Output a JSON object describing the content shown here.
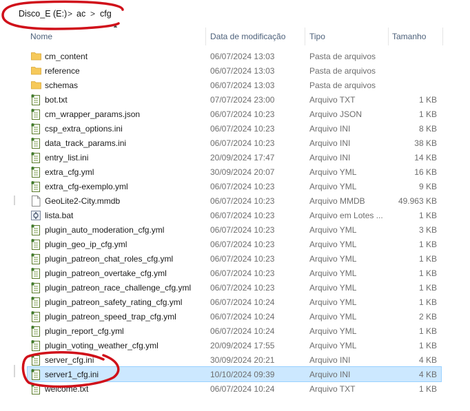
{
  "breadcrumb": {
    "items": [
      "Disco_E (E:)",
      "ac",
      "cfg"
    ],
    "separator": ">"
  },
  "columns": {
    "name": "Nome",
    "date": "Data de modificação",
    "type": "Tipo",
    "size": "Tamanho"
  },
  "files": [
    {
      "name": "cm_content",
      "date": "06/07/2024 13:03",
      "type": "Pasta de arquivos",
      "size": "",
      "icon": "folder-icon"
    },
    {
      "name": "reference",
      "date": "06/07/2024 13:03",
      "type": "Pasta de arquivos",
      "size": "",
      "icon": "folder-icon"
    },
    {
      "name": "schemas",
      "date": "06/07/2024 13:03",
      "type": "Pasta de arquivos",
      "size": "",
      "icon": "folder-icon"
    },
    {
      "name": "bot.txt",
      "date": "07/07/2024 23:00",
      "type": "Arquivo TXT",
      "size": "1 KB",
      "icon": "notepad-file-icon"
    },
    {
      "name": "cm_wrapper_params.json",
      "date": "06/07/2024 10:23",
      "type": "Arquivo JSON",
      "size": "1 KB",
      "icon": "notepad-file-icon"
    },
    {
      "name": "csp_extra_options.ini",
      "date": "06/07/2024 10:23",
      "type": "Arquivo INI",
      "size": "8 KB",
      "icon": "notepad-file-icon"
    },
    {
      "name": "data_track_params.ini",
      "date": "06/07/2024 10:23",
      "type": "Arquivo INI",
      "size": "38 KB",
      "icon": "notepad-file-icon"
    },
    {
      "name": "entry_list.ini",
      "date": "20/09/2024 17:47",
      "type": "Arquivo INI",
      "size": "14 KB",
      "icon": "notepad-file-icon"
    },
    {
      "name": "extra_cfg.yml",
      "date": "30/09/2024 20:07",
      "type": "Arquivo YML",
      "size": "16 KB",
      "icon": "notepad-file-icon"
    },
    {
      "name": "extra_cfg-exemplo.yml",
      "date": "06/07/2024 10:23",
      "type": "Arquivo YML",
      "size": "9 KB",
      "icon": "notepad-file-icon"
    },
    {
      "name": "GeoLite2-City.mmdb",
      "date": "06/07/2024 10:23",
      "type": "Arquivo MMDB",
      "size": "49.963 KB",
      "icon": "blank-file-icon"
    },
    {
      "name": "lista.bat",
      "date": "06/07/2024 10:23",
      "type": "Arquivo em Lotes ...",
      "size": "1 KB",
      "icon": "batch-file-icon"
    },
    {
      "name": "plugin_auto_moderation_cfg.yml",
      "date": "06/07/2024 10:23",
      "type": "Arquivo YML",
      "size": "3 KB",
      "icon": "notepad-file-icon"
    },
    {
      "name": "plugin_geo_ip_cfg.yml",
      "date": "06/07/2024 10:23",
      "type": "Arquivo YML",
      "size": "1 KB",
      "icon": "notepad-file-icon"
    },
    {
      "name": "plugin_patreon_chat_roles_cfg.yml",
      "date": "06/07/2024 10:23",
      "type": "Arquivo YML",
      "size": "1 KB",
      "icon": "notepad-file-icon"
    },
    {
      "name": "plugin_patreon_overtake_cfg.yml",
      "date": "06/07/2024 10:23",
      "type": "Arquivo YML",
      "size": "1 KB",
      "icon": "notepad-file-icon"
    },
    {
      "name": "plugin_patreon_race_challenge_cfg.yml",
      "date": "06/07/2024 10:23",
      "type": "Arquivo YML",
      "size": "1 KB",
      "icon": "notepad-file-icon"
    },
    {
      "name": "plugin_patreon_safety_rating_cfg.yml",
      "date": "06/07/2024 10:24",
      "type": "Arquivo YML",
      "size": "1 KB",
      "icon": "notepad-file-icon"
    },
    {
      "name": "plugin_patreon_speed_trap_cfg.yml",
      "date": "06/07/2024 10:24",
      "type": "Arquivo YML",
      "size": "2 KB",
      "icon": "notepad-file-icon"
    },
    {
      "name": "plugin_report_cfg.yml",
      "date": "06/07/2024 10:24",
      "type": "Arquivo YML",
      "size": "1 KB",
      "icon": "notepad-file-icon"
    },
    {
      "name": "plugin_voting_weather_cfg.yml",
      "date": "20/09/2024 17:55",
      "type": "Arquivo YML",
      "size": "1 KB",
      "icon": "notepad-file-icon"
    },
    {
      "name": "server_cfg.ini",
      "date": "30/09/2024 20:21",
      "type": "Arquivo INI",
      "size": "4 KB",
      "icon": "notepad-file-icon"
    },
    {
      "name": "server1_cfg.ini",
      "date": "10/10/2024 09:39",
      "type": "Arquivo INI",
      "size": "4 KB",
      "icon": "notepad-file-icon",
      "selected": true
    },
    {
      "name": "welcome.txt",
      "date": "06/07/2024 10:24",
      "type": "Arquivo TXT",
      "size": "1 KB",
      "icon": "notepad-file-icon"
    }
  ],
  "colors": {
    "annotation": "#d0101a",
    "selection": "#cce8ff",
    "folder": "#f6c95b",
    "header_text": "#4c607a"
  }
}
